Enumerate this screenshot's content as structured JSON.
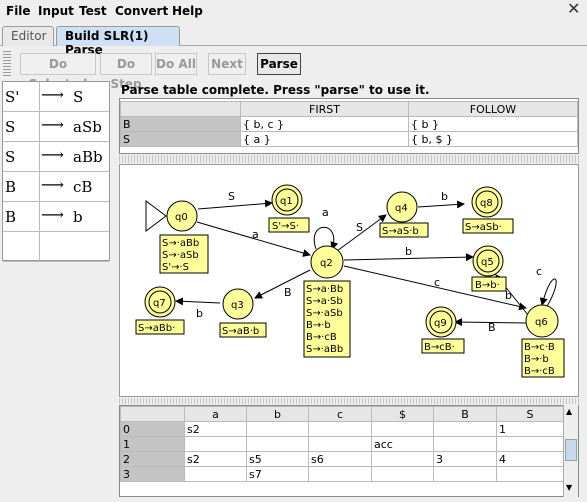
{
  "menu": [
    "File",
    "Input",
    "Test",
    "Convert",
    "Help"
  ],
  "tabs": {
    "editor": "Editor",
    "build": "Build SLR(1) Parse"
  },
  "toolbar": {
    "do_selected": "Do Selected",
    "do_step": "Do Step",
    "do_all": "Do All",
    "next": "Next",
    "parse": "Parse"
  },
  "grammar": [
    {
      "lhs": "S'",
      "rhs": "S"
    },
    {
      "lhs": "S",
      "rhs": "aSb"
    },
    {
      "lhs": "S",
      "rhs": "aBb"
    },
    {
      "lhs": "B",
      "rhs": "cB"
    },
    {
      "lhs": "B",
      "rhs": "b"
    }
  ],
  "arrow_glyph": "⟶",
  "status": "Parse table complete.  Press \"parse\" to use it.",
  "first_follow": {
    "headers": [
      "",
      "FIRST",
      "FOLLOW"
    ],
    "rows": [
      [
        "B",
        "{ b, c }",
        "{ b }"
      ],
      [
        "S",
        "{ a }",
        "{ b, $ }"
      ]
    ]
  },
  "dfa": {
    "states": [
      {
        "id": "q0",
        "label": "q0",
        "items": [
          "S→·aBb",
          "S→·aSb",
          "S'→·S"
        ]
      },
      {
        "id": "q1",
        "label": "q1",
        "items": [
          "S'→S·"
        ]
      },
      {
        "id": "q2",
        "label": "q2",
        "items": [
          "S→a·Bb",
          "S→a·Sb",
          "S→·aSb",
          "B→·b",
          "B→·cB",
          "S→·aBb"
        ]
      },
      {
        "id": "q3",
        "label": "q3",
        "items": [
          "S→aB·b"
        ]
      },
      {
        "id": "q4",
        "label": "q4",
        "items": [
          "S→aS·b"
        ]
      },
      {
        "id": "q5",
        "label": "q5",
        "items": [
          "B→b·"
        ]
      },
      {
        "id": "q6",
        "label": "q6",
        "items": [
          "B→c·B",
          "B→·b",
          "B→·cB"
        ]
      },
      {
        "id": "q7",
        "label": "q7",
        "items": [
          "S→aBb·"
        ]
      },
      {
        "id": "q8",
        "label": "q8",
        "items": [
          "S→aSb·"
        ]
      },
      {
        "id": "q9",
        "label": "q9",
        "items": [
          "B→cB·"
        ]
      }
    ],
    "edge_labels": [
      "S",
      "a",
      "a",
      "S",
      "b",
      "b",
      "c",
      "B",
      "b",
      "c",
      "b",
      "B"
    ]
  },
  "parse_table": {
    "headers": [
      "",
      "a",
      "b",
      "c",
      "$",
      "B",
      "S"
    ],
    "rows": [
      [
        "0",
        "s2",
        "",
        "",
        "",
        "",
        "1"
      ],
      [
        "1",
        "",
        "",
        "",
        "acc",
        "",
        ""
      ],
      [
        "2",
        "s2",
        "s5",
        "s6",
        "",
        "3",
        "4"
      ],
      [
        "3",
        "",
        "s7",
        "",
        "",
        "",
        ""
      ]
    ]
  }
}
